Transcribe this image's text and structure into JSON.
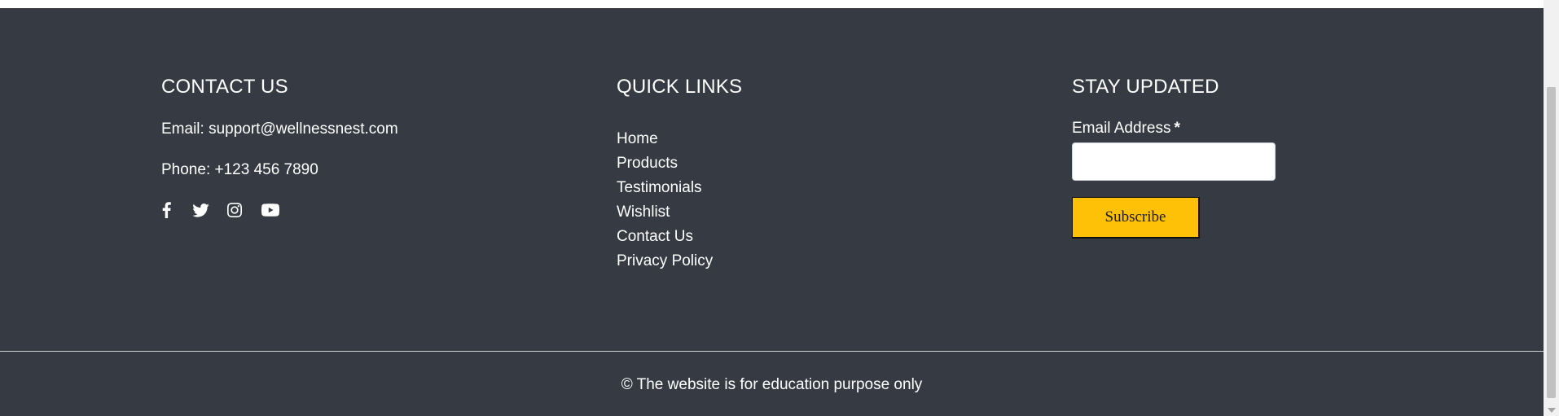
{
  "contact": {
    "title": "CONTACT US",
    "email": "Email: support@wellnessnest.com",
    "phone": "Phone: +123 456 7890",
    "socials": [
      "facebook-icon",
      "twitter-icon",
      "instagram-icon",
      "youtube-icon"
    ]
  },
  "quick_links": {
    "title": "QUICK LINKS",
    "items": [
      "Home",
      "Products",
      "Testimonials",
      "Wishlist",
      "Contact Us",
      "Privacy Policy"
    ]
  },
  "newsletter": {
    "title": "STAY UPDATED",
    "email_label": "Email Address",
    "required_marker": "*",
    "email_value": "",
    "subscribe_label": "Subscribe"
  },
  "footer": {
    "copyright": "© The website is for education purpose only"
  },
  "colors": {
    "background": "#363a42",
    "button": "#ffc107",
    "text": "#ffffff"
  }
}
